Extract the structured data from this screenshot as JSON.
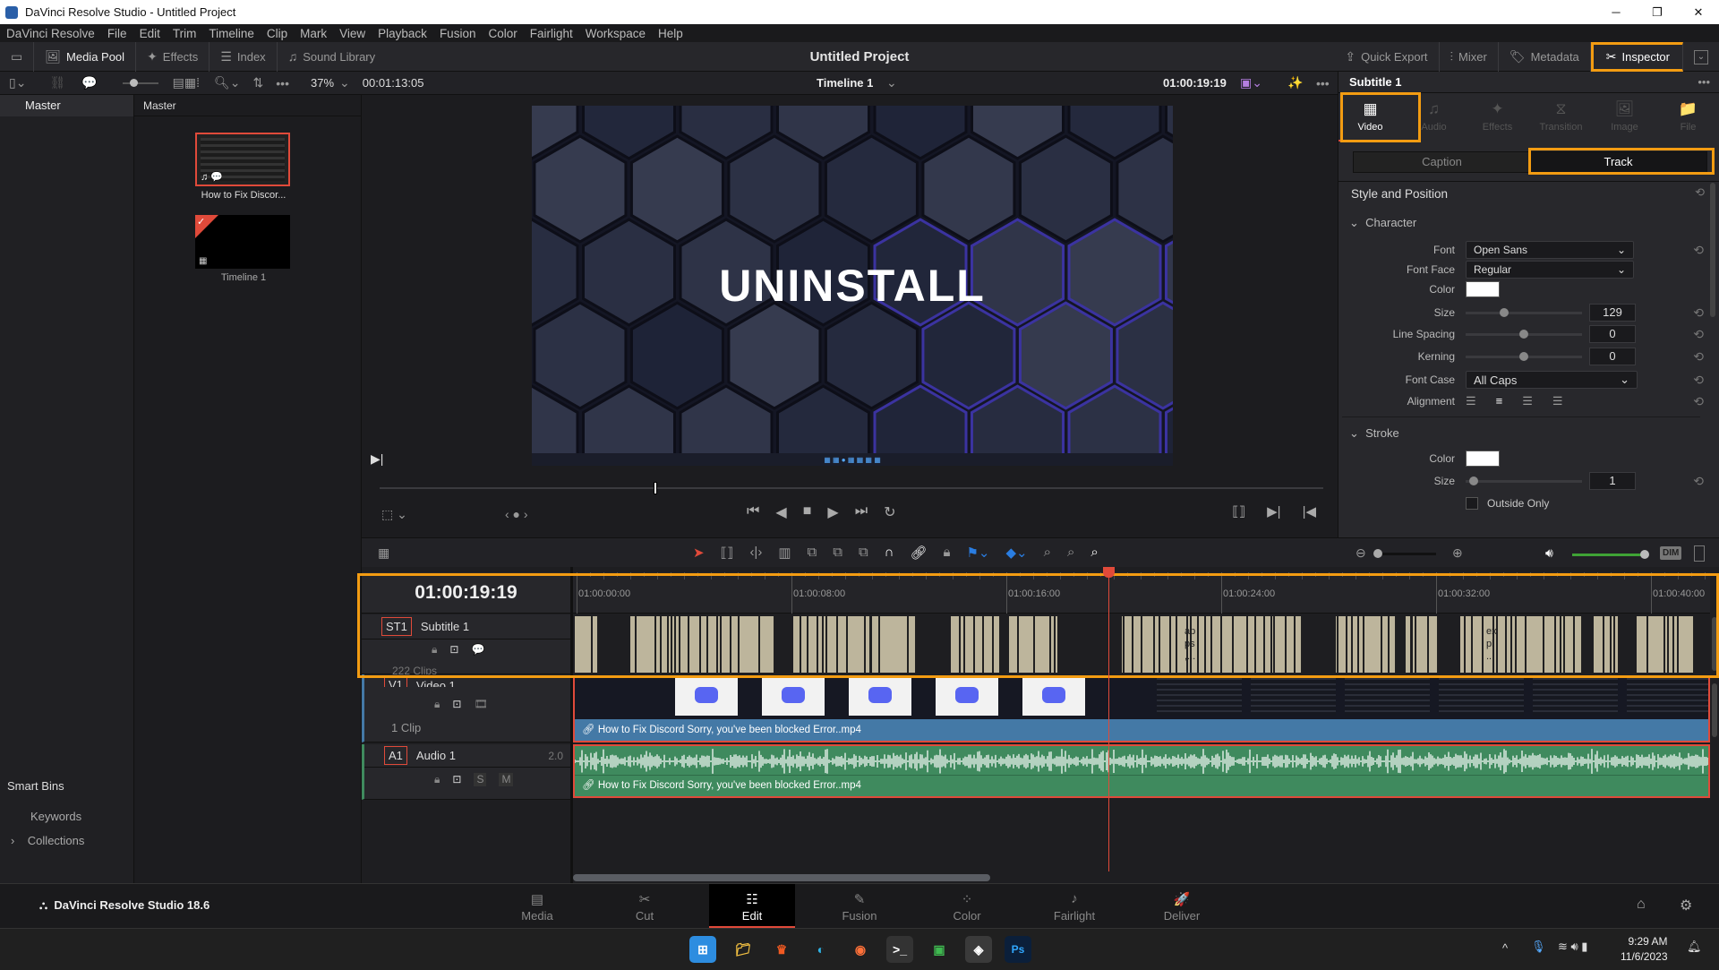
{
  "window": {
    "title": "DaVinci Resolve Studio - Untitled Project",
    "minimize": "─",
    "maximize": "❐",
    "close": "✕"
  },
  "menu": [
    "DaVinci Resolve",
    "File",
    "Edit",
    "Trim",
    "Timeline",
    "Clip",
    "Mark",
    "View",
    "Playback",
    "Fusion",
    "Color",
    "Fairlight",
    "Workspace",
    "Help"
  ],
  "toolbar": {
    "media_pool": "Media Pool",
    "effects": "Effects",
    "index": "Index",
    "sound_library": "Sound Library",
    "project_title": "Untitled Project",
    "quick_export": "Quick Export",
    "mixer": "Mixer",
    "metadata": "Metadata",
    "inspector": "Inspector"
  },
  "viewer_bar": {
    "zoom": "37%",
    "source_duration": "00:01:13:05",
    "timeline_name": "Timeline 1",
    "timecode": "01:00:19:19"
  },
  "bins": {
    "master": "Master",
    "smart_bins": "Smart Bins",
    "items": [
      "Keywords",
      "Collections"
    ]
  },
  "media_pool": {
    "header": "Master",
    "clips": [
      {
        "name": "How to Fix Discor..."
      },
      {
        "name": "Timeline 1"
      }
    ]
  },
  "viewer": {
    "subtitle_text": "UNINSTALL",
    "scrub_progress": 0.29
  },
  "inspector": {
    "title": "Subtitle 1",
    "tabs": [
      {
        "label": "Video",
        "active": true
      },
      {
        "label": "Audio"
      },
      {
        "label": "Effects"
      },
      {
        "label": "Transition"
      },
      {
        "label": "Image"
      },
      {
        "label": "File"
      }
    ],
    "subtabs": [
      {
        "label": "Caption"
      },
      {
        "label": "Track",
        "active": true
      }
    ],
    "section": "Style and Position",
    "character": {
      "heading": "Character",
      "font_label": "Font",
      "font": "Open Sans",
      "font_face_label": "Font Face",
      "font_face": "Regular",
      "color_label": "Color",
      "color": "#ffffff",
      "size_label": "Size",
      "size": "129",
      "line_spacing_label": "Line Spacing",
      "line_spacing": "0",
      "kerning_label": "Kerning",
      "kerning": "0",
      "font_case_label": "Font Case",
      "font_case": "All Caps",
      "alignment_label": "Alignment",
      "alignment": "center"
    },
    "stroke": {
      "heading": "Stroke",
      "color_label": "Color",
      "color": "#ffffff",
      "size_label": "Size",
      "size": "1",
      "outside_only": "Outside Only",
      "outside_only_checked": false
    }
  },
  "timeline": {
    "timecode": "01:00:19:19",
    "ruler": [
      "01:00:00:00",
      "01:00:08:00",
      "01:00:16:00",
      "01:00:24:00",
      "01:00:32:00",
      "01:00:40:00"
    ],
    "playhead": "01:00:19:19",
    "tracks": [
      {
        "tag": "ST1",
        "name": "Subtitle 1",
        "clips": "222 Clips",
        "clip_texts": [
          "ap ps ,...",
          "ex pl ..."
        ]
      },
      {
        "tag": "V1",
        "name": "Video 1",
        "clips": "1 Clip",
        "clip_name": "How to Fix Discord Sorry, you've been blocked Error..mp4"
      },
      {
        "tag": "A1",
        "name": "Audio 1",
        "channels": "2.0",
        "solo": "S",
        "mute": "M",
        "clip_name": "How to Fix Discord Sorry, you've been blocked Error..mp4"
      }
    ],
    "dim": "DIM"
  },
  "pages": [
    {
      "label": "Media"
    },
    {
      "label": "Cut"
    },
    {
      "label": "Edit",
      "active": true
    },
    {
      "label": "Fusion"
    },
    {
      "label": "Color"
    },
    {
      "label": "Fairlight"
    },
    {
      "label": "Deliver"
    }
  ],
  "app_version": "DaVinci Resolve Studio 18.6",
  "taskbar": {
    "time": "9:29 AM",
    "date": "11/6/2023"
  },
  "colors": {
    "accent_highlight": "#f39c12",
    "playhead": "#e04a3a",
    "video_clip": "#4479a6",
    "audio_clip": "#3f8a5e",
    "subtitle_clip": "#bdb59c"
  }
}
